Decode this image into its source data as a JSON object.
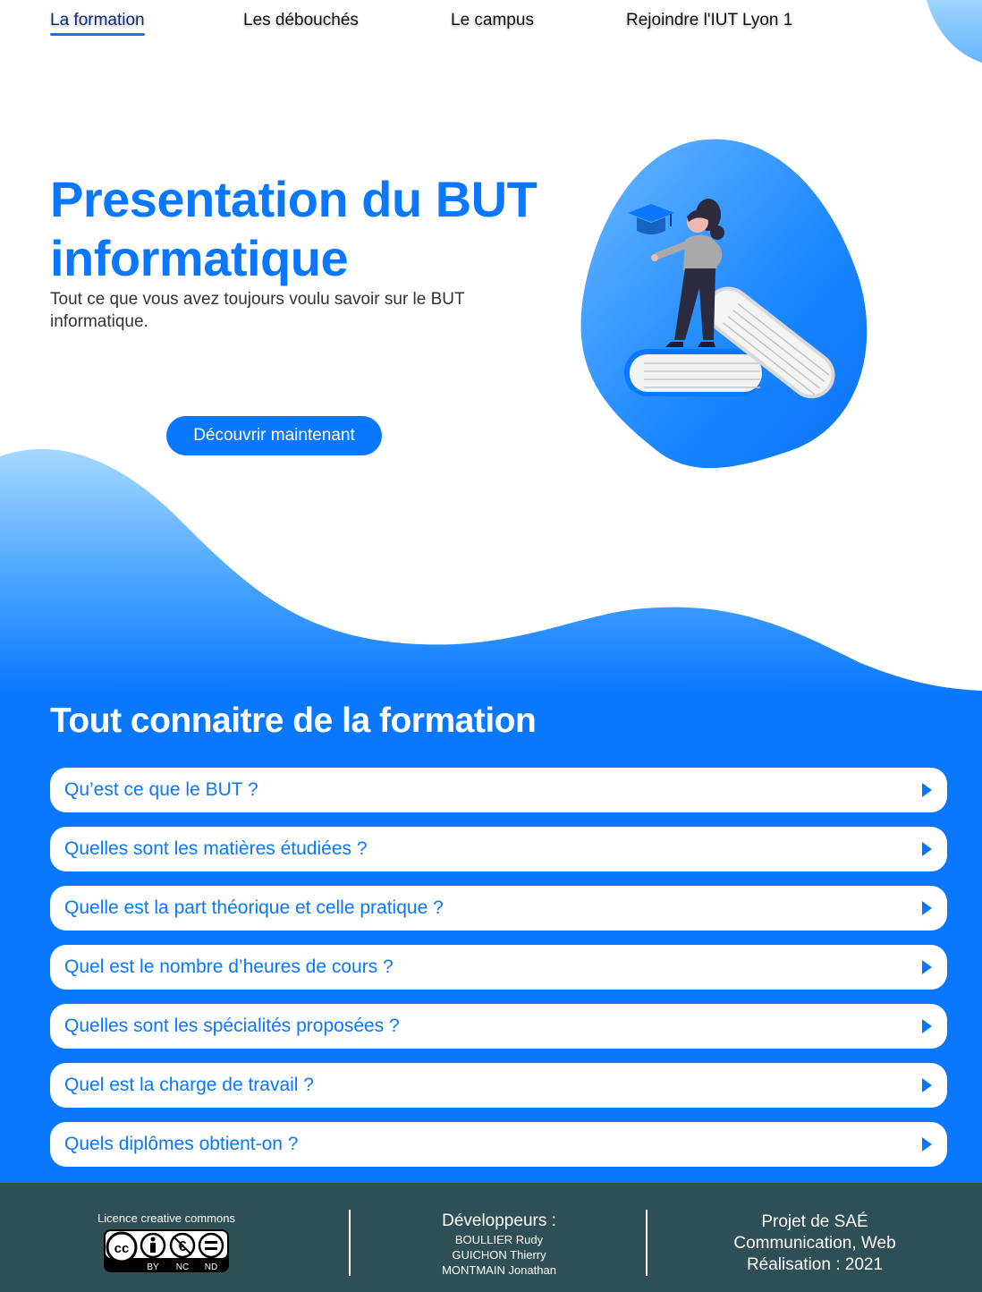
{
  "nav": {
    "items": [
      {
        "label": "La formation",
        "active": true
      },
      {
        "label": "Les débouchés",
        "active": false
      },
      {
        "label": "Le campus",
        "active": false
      },
      {
        "label": "Rejoindre l'IUT Lyon 1",
        "active": false
      }
    ]
  },
  "hero": {
    "title": "Presentation du BUT informatique",
    "subtitle": "Tout ce que vous avez toujours voulu savoir sur le BUT informatique.",
    "cta_label": "Découvrir maintenant"
  },
  "section": {
    "title": "Tout connaitre de la formation"
  },
  "faq": [
    "Qu’est ce que le BUT ?",
    "Quelles sont les matières étudiées ?",
    "Quelle est la part théorique et celle pratique ?",
    "Quel est le nombre d’heures de cours ?",
    "Quelles sont les spécialités proposées ?",
    "Quel est la charge de travail ?",
    "Quels diplômes obtient-on ?"
  ],
  "footer": {
    "license_title": "Licence creative commons",
    "license_badge": {
      "cc": "cc",
      "terms": [
        "BY",
        "NC",
        "ND"
      ]
    },
    "devs_title": "Développeurs :",
    "devs": [
      "BOULLIER Rudy",
      "GUICHON Thierry",
      "MONTMAIN Jonathan"
    ],
    "project_lines": [
      "Projet de SAÉ",
      "Communication, Web",
      "Réalisation : 2021"
    ]
  },
  "colors": {
    "primary": "#0a77ff",
    "light_blue": "#8ecbff",
    "footer": "#2f4f56"
  }
}
